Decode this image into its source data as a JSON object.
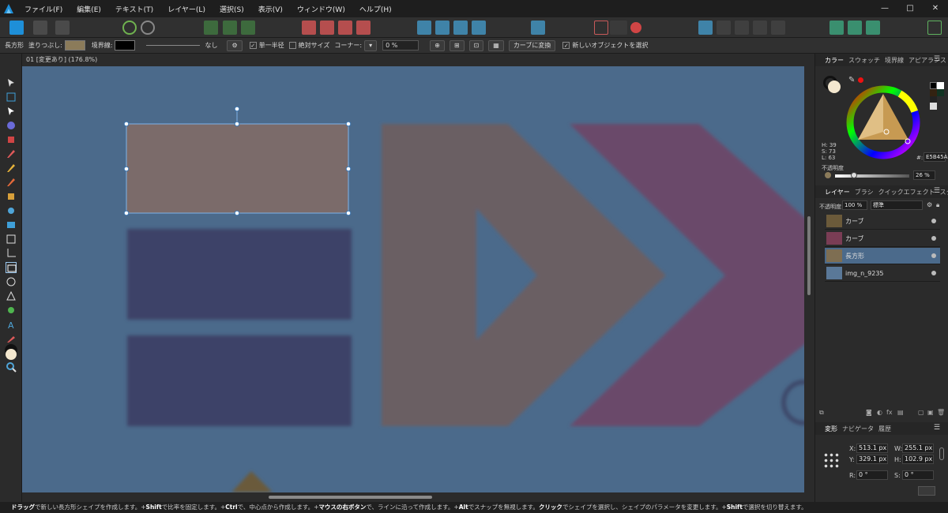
{
  "menu": {
    "items": [
      "ファイル(F)",
      "編集(E)",
      "テキスト(T)",
      "レイヤー(L)",
      "選択(S)",
      "表示(V)",
      "ウィンドウ(W)",
      "ヘルプ(H)"
    ],
    "min": "—",
    "max": "□",
    "close": "✕"
  },
  "context": {
    "tool_label": "長方形",
    "fill_label": "塗りつぶし:",
    "fill_color": "#8b7b5a",
    "stroke_label": "境界線:",
    "stroke_color": "#000000",
    "stroke_none": "なし",
    "uniform_radius": "単一半径",
    "absolute_size": "絶対サイズ",
    "corner_label": "コーナー:",
    "corner_value": "0 %",
    "convert_to_curves": "カーブに変換",
    "new_objects_select": "新しいオブジェクトを選択"
  },
  "document": {
    "tab_title": "01 [変更あり] (176.8%)"
  },
  "color_panel": {
    "tabs": [
      "カラー",
      "スウォッチ",
      "境界線",
      "アピアランス"
    ],
    "h_label": "H: 39",
    "s_label": "S: 73",
    "l_label": "L: 63",
    "hex": "E5B45A",
    "opacity_label": "不透明度",
    "opacity_value": "26 %",
    "opacity_fraction": 0.26
  },
  "layers_panel": {
    "tabs": [
      "レイヤー",
      "ブラシ",
      "クイックエフェクト",
      "スタイル"
    ],
    "opacity_label": "不透明度:",
    "opacity_value": "100 %",
    "blend_mode": "標準",
    "layers": [
      {
        "name": "カーブ",
        "thumb": "#6b5a3a",
        "selected": false
      },
      {
        "name": "カーブ",
        "thumb": "#7a3d55",
        "selected": false
      },
      {
        "name": "長方形",
        "thumb": "#7e6e52",
        "selected": true
      },
      {
        "name": "img_n_9235",
        "thumb": "#5a7898",
        "selected": false
      }
    ]
  },
  "transform_panel": {
    "tabs": [
      "変形",
      "ナビゲータ",
      "履歴"
    ],
    "x_label": "X:",
    "x": "513.1 px",
    "y_label": "Y:",
    "y": "329.1 px",
    "w_label": "W:",
    "w": "255.1 px",
    "h_label": "H:",
    "h": "102.9 px",
    "r_label": "R:",
    "r": "0 °",
    "s_label": "S:",
    "s": "0 °"
  },
  "status": {
    "seg1_b": "ドラッグ",
    "seg1": "で新しい長方形シェイプを作成します。+",
    "seg2_b": "Shift",
    "seg2": "で比率を固定します。+",
    "seg3_b": "Ctrl",
    "seg3": "で、中心点から作成します。+",
    "seg4_b": "マウスの右ボタン",
    "seg4": "で、ラインに沿って作成します。+",
    "seg5_b": "Alt",
    "seg5": "でスナップを無視します。",
    "seg6_b": "クリック",
    "seg6": "でシェイプを選択し、シェイプのパラメータを変更します。+",
    "seg7_b": "Shift",
    "seg7": "で選択を切り替えます。"
  }
}
